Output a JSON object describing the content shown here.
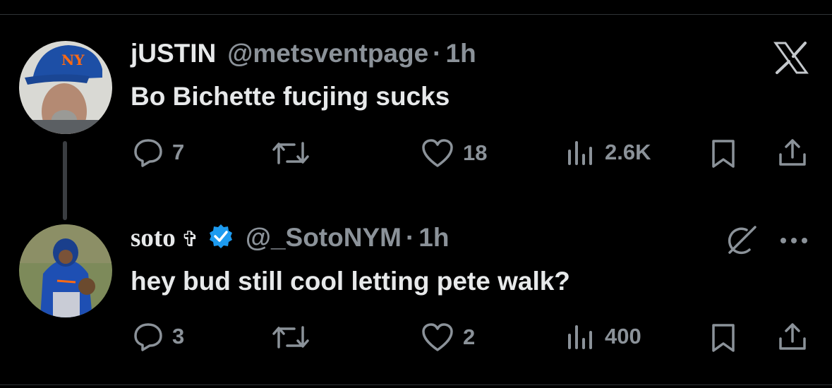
{
  "tweets": [
    {
      "name": "jUSTIN",
      "handle": "@metsventpage",
      "separator": "·",
      "time": "1h",
      "text": "Bo Bichette fucjing sucks",
      "stats": {
        "replies": "7",
        "retweets": "",
        "likes": "18",
        "views": "2.6K"
      }
    },
    {
      "name": "soto",
      "name_symbol": "✞",
      "verified": true,
      "handle": "@_SotoNYM",
      "separator": "·",
      "time": "1h",
      "text": "hey bud still cool letting pete walk?",
      "stats": {
        "replies": "3",
        "retweets": "",
        "likes": "2",
        "views": "400"
      }
    }
  ],
  "colors": {
    "background": "#000000",
    "text": "#e7e9ea",
    "muted": "#8b9299",
    "verified": "#1d9bf0"
  },
  "icons": [
    "x-logo-icon",
    "reply-icon",
    "retweet-icon",
    "like-icon",
    "views-icon",
    "bookmark-icon",
    "share-icon",
    "grok-icon",
    "more-icon",
    "verified-badge-icon"
  ]
}
